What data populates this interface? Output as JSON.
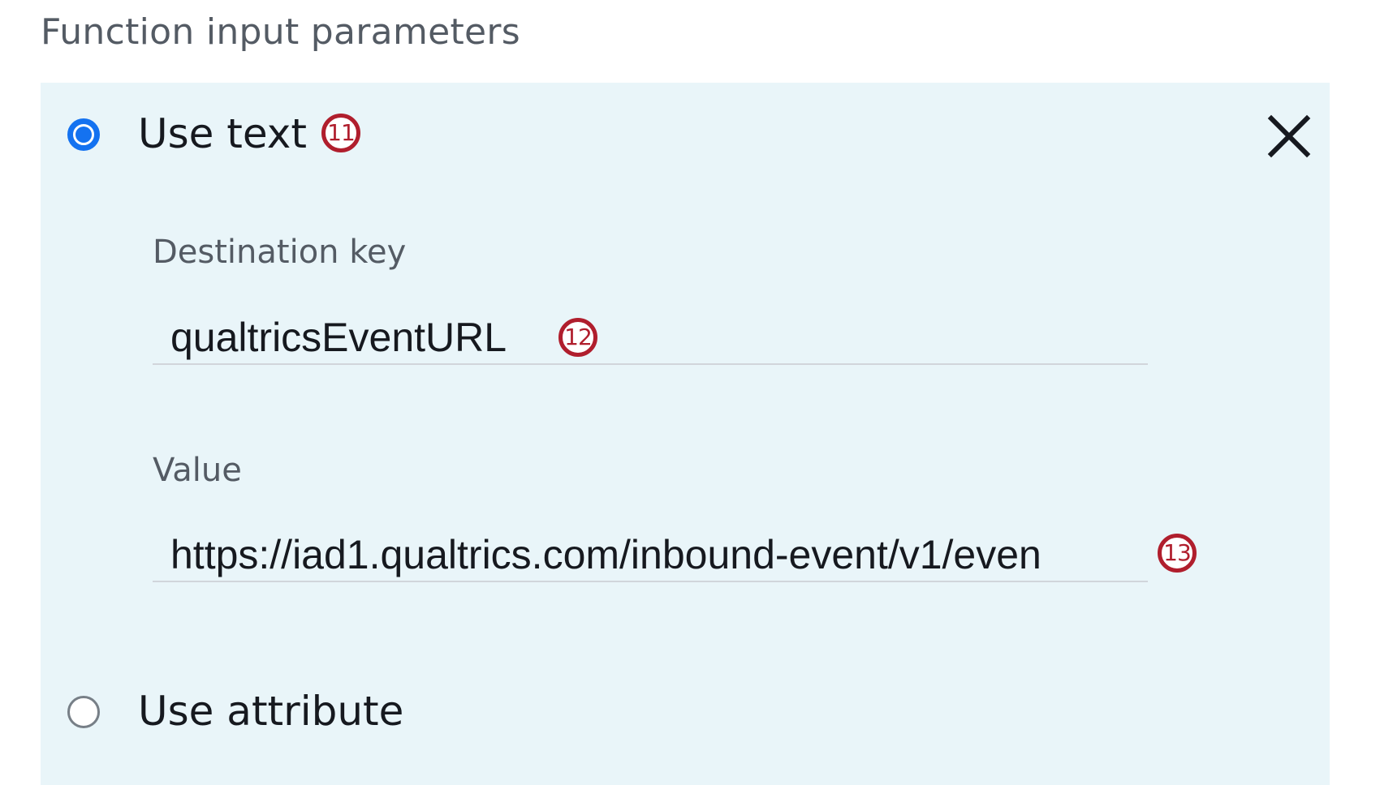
{
  "section": {
    "title": "Function input parameters"
  },
  "options": {
    "use_text": {
      "label": "Use text",
      "selected": true,
      "callout": "11"
    },
    "use_attribute": {
      "label": "Use attribute",
      "selected": false
    }
  },
  "fields": {
    "destination_key": {
      "label": "Destination key",
      "value": "qualtricsEventURL",
      "callout": "12"
    },
    "value": {
      "label": "Value",
      "value": "https://iad1.qualtrics.com/inbound-event/v1/even",
      "callout": "13"
    }
  },
  "icons": {
    "close": "close-icon"
  },
  "colors": {
    "panel_background": "#e9f5f9",
    "radio_selected": "#1472f0",
    "callout_border": "#b01e2d",
    "label_text": "#545b64",
    "body_text": "#16191f"
  }
}
